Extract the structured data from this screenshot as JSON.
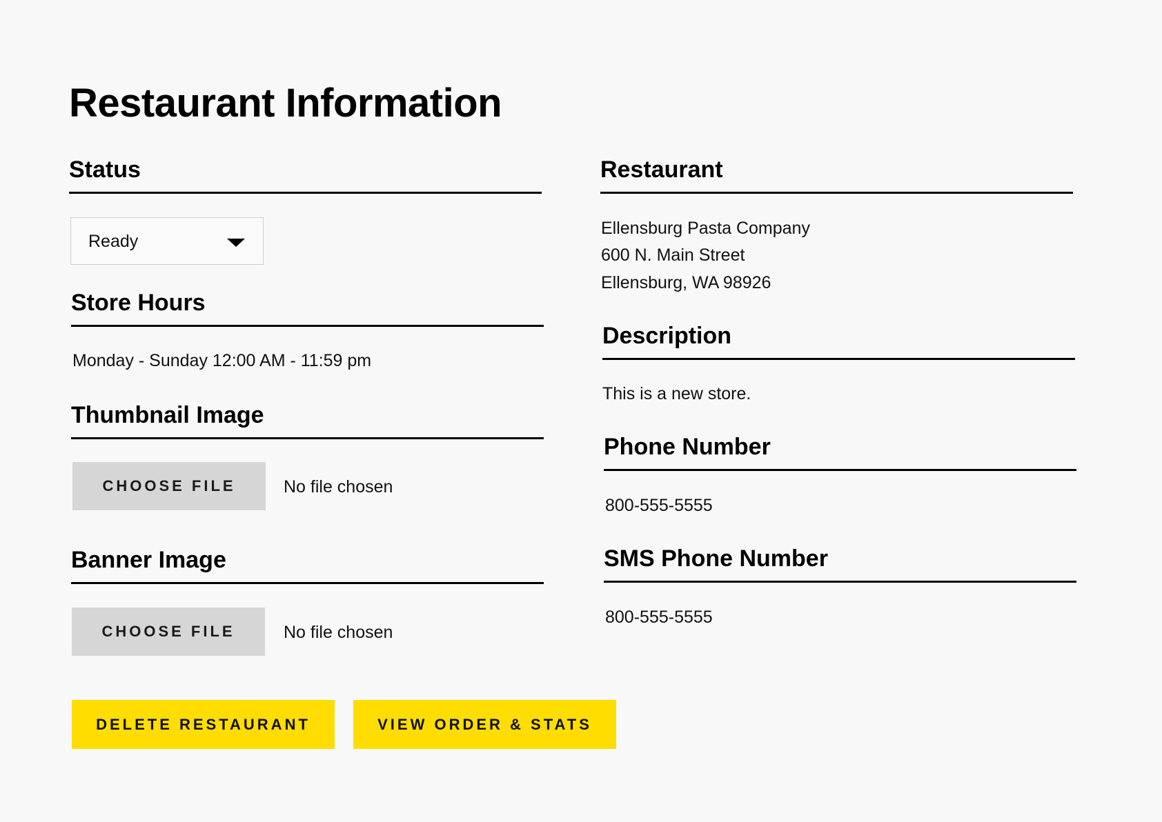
{
  "page": {
    "title": "Restaurant Information"
  },
  "status": {
    "heading": "Status",
    "selected": "Ready"
  },
  "store_hours": {
    "heading": "Store Hours",
    "value": "Monday - Sunday 12:00 AM - 11:59 pm"
  },
  "thumbnail": {
    "heading": "Thumbnail Image",
    "button_label": "CHOOSE FILE",
    "file_status": "No file chosen"
  },
  "banner": {
    "heading": "Banner Image",
    "button_label": "CHOOSE FILE",
    "file_status": "No file chosen"
  },
  "restaurant": {
    "heading": "Restaurant",
    "name": "Ellensburg Pasta Company",
    "street": "600 N. Main Street",
    "city_state_zip": "Ellensburg, WA 98926"
  },
  "description": {
    "heading": "Description",
    "value": "This is a new store."
  },
  "phone": {
    "heading": "Phone Number",
    "value": "800-555-5555"
  },
  "sms_phone": {
    "heading": "SMS Phone Number",
    "value": "800-555-5555"
  },
  "actions": {
    "delete_label": "DELETE RESTAURANT",
    "view_label": "VIEW ORDER & STATS"
  },
  "colors": {
    "background": "#f8f8f8",
    "accent": "#ffdd00",
    "file_button": "#d6d6d6"
  },
  "icons": {
    "status_dropdown": "caret-down-icon"
  }
}
